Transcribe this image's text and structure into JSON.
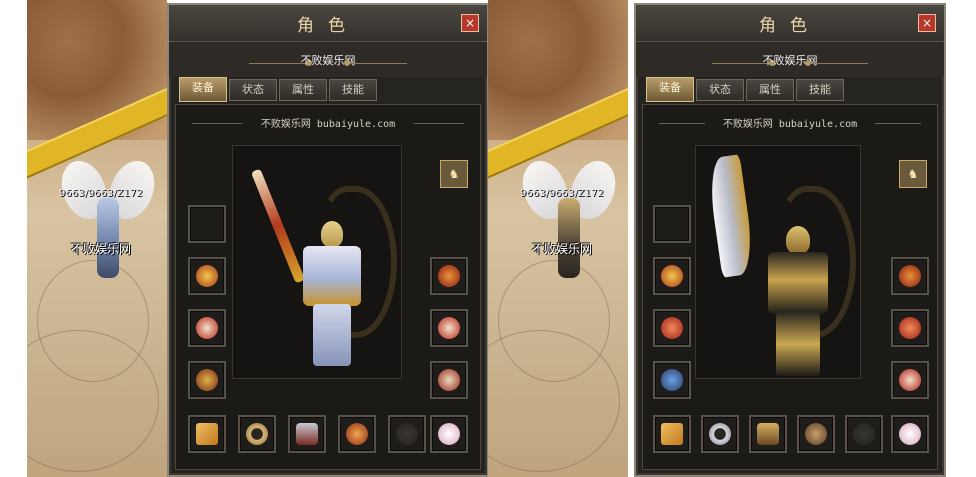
{
  "screens": [
    {
      "player": {
        "stats": "9663/9663/Z172",
        "name": "不败娱乐网"
      },
      "panel": {
        "title": "角色",
        "close_label": "×",
        "char_name": "不败娱乐网",
        "tabs": [
          {
            "label": "装备",
            "active": true
          },
          {
            "label": "状态"
          },
          {
            "label": "属性"
          },
          {
            "label": "技能"
          }
        ],
        "site_text": "不败娱乐网 bubaiyule.com",
        "config_icon": "emblem-icon"
      },
      "equipment": {
        "left": [
          "empty-slot",
          "necklace",
          "bracelet",
          "amulet"
        ],
        "right": [
          "medal",
          "bracelet",
          "ring"
        ],
        "bottom": [
          "charm-book",
          "belt",
          "boots",
          "gem",
          "empty-slot",
          "lotus"
        ]
      }
    },
    {
      "player": {
        "stats": "9663/9663/Z172",
        "name": "不败娱乐网"
      },
      "panel": {
        "title": "角色",
        "close_label": "×",
        "char_name": "不败娱乐网",
        "tabs": [
          {
            "label": "装备",
            "active": true
          },
          {
            "label": "状态"
          },
          {
            "label": "属性"
          },
          {
            "label": "技能"
          }
        ],
        "site_text": "不败娱乐网 bubaiyule.com",
        "config_icon": "emblem-icon"
      },
      "equipment": {
        "left": [
          "empty-slot",
          "necklace",
          "bracelet",
          "amulet"
        ],
        "right": [
          "medal",
          "bracelet",
          "ring"
        ],
        "bottom": [
          "charm-book",
          "belt",
          "boots",
          "gem",
          "empty-slot",
          "lotus"
        ]
      }
    }
  ],
  "colors": {
    "panel_bg": "#262420",
    "title": "#e9d6a8",
    "close": "#b8362a",
    "tab_active": "#b79c6a"
  }
}
